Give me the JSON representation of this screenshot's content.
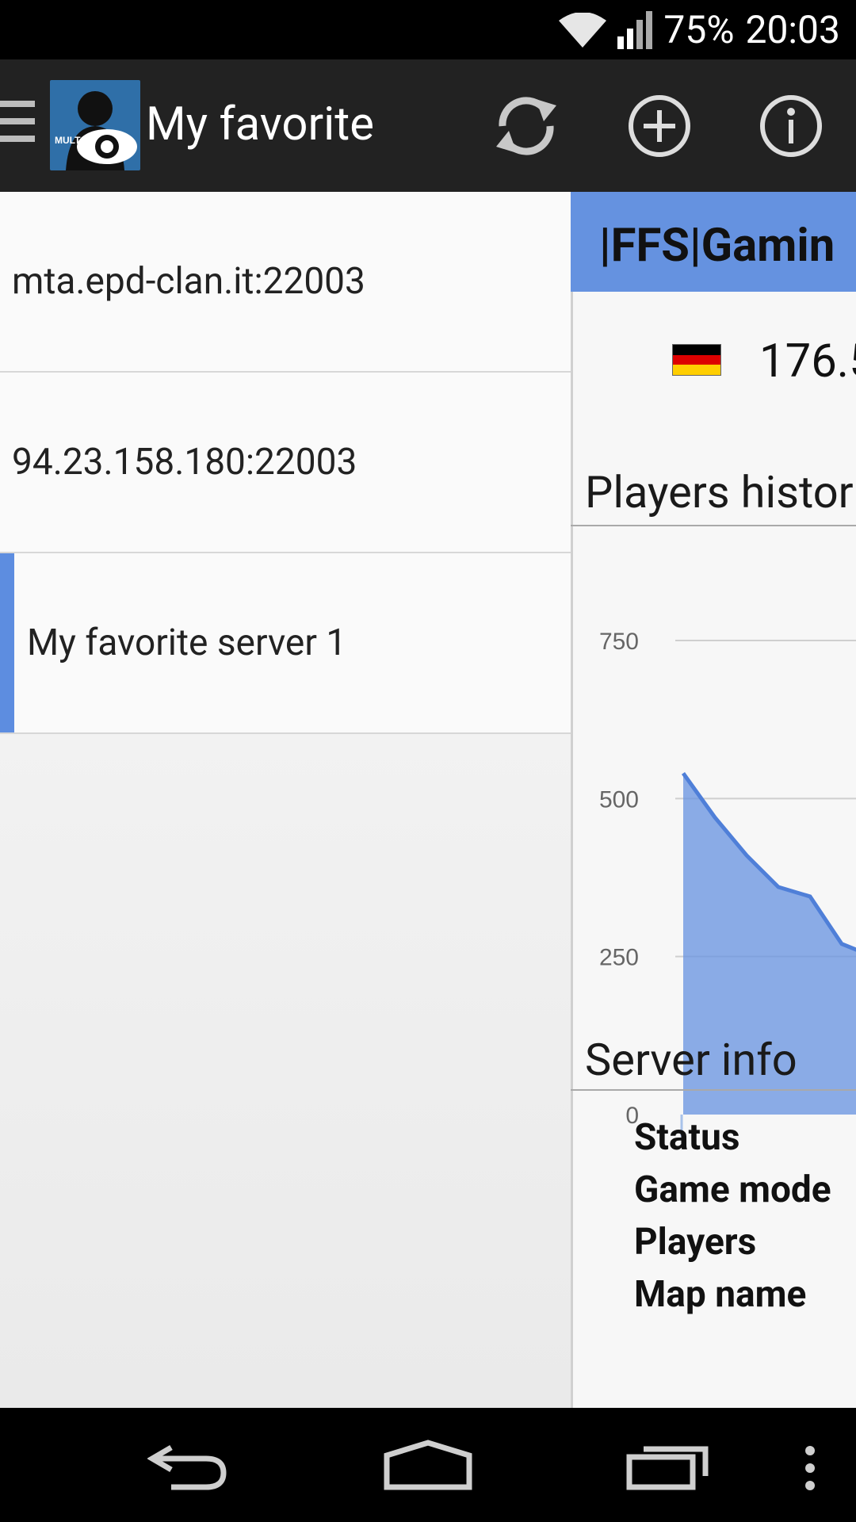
{
  "status_bar": {
    "battery": "75%",
    "time": "20:03"
  },
  "action_bar": {
    "title": "My favorite",
    "app_icon_text": "MULT",
    "actions": [
      {
        "name": "refresh",
        "icon": "refresh-icon"
      },
      {
        "name": "add",
        "icon": "add-circle-icon"
      },
      {
        "name": "info",
        "icon": "info-icon"
      }
    ]
  },
  "servers": [
    {
      "label": "mta.epd-clan.it:22003",
      "selected": false
    },
    {
      "label": "94.23.158.180:22003",
      "selected": false
    },
    {
      "label": "My favorite server 1",
      "selected": true
    }
  ],
  "detail": {
    "server_name": "|FFS|Gamin",
    "ip_partial": "176.5",
    "players_history_title": "Players histor",
    "server_info_title": "Server info",
    "info_labels": [
      "Status",
      "Game mode",
      "Players",
      "Map name"
    ]
  },
  "chart_data": {
    "type": "area",
    "title": "Players histor",
    "yticks": [
      "750",
      "500",
      "250",
      "0"
    ],
    "ylim": [
      0,
      750
    ],
    "grid": true,
    "series": [
      {
        "values": [
          540,
          470,
          410,
          360,
          345,
          270,
          250
        ]
      }
    ],
    "color": "#6592e0"
  },
  "colors": {
    "accent": "#6592e0",
    "actionbar": "#222222"
  }
}
